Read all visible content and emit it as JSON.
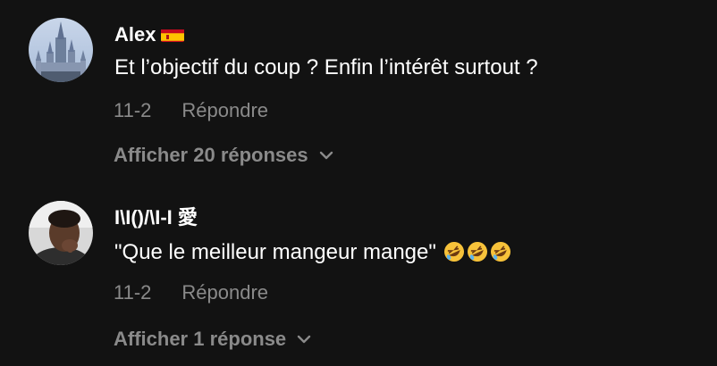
{
  "comments": [
    {
      "author": "Alex",
      "author_flag_icon": "spain-flag-icon",
      "text": "Et l’objectif du coup ? Enfin l’intérêt surtout ?",
      "date": "11-2",
      "reply_label": "Répondre",
      "show_replies_label": "Afficher 20 réponses",
      "avatar_icon": "castle-avatar"
    },
    {
      "author": "I\\I()/\\I-I 愛",
      "text": "\"Que le meilleur mangeur mange\"",
      "emoji_icons": [
        "rofl-emoji-icon",
        "rofl-emoji-icon",
        "rofl-emoji-icon"
      ],
      "date": "11-2",
      "reply_label": "Répondre",
      "show_replies_label": "Afficher 1 réponse",
      "avatar_icon": "person-avatar"
    }
  ],
  "colors": {
    "background": "#121212",
    "primary_text": "#ffffff",
    "secondary_text": "#8a8a8a"
  }
}
